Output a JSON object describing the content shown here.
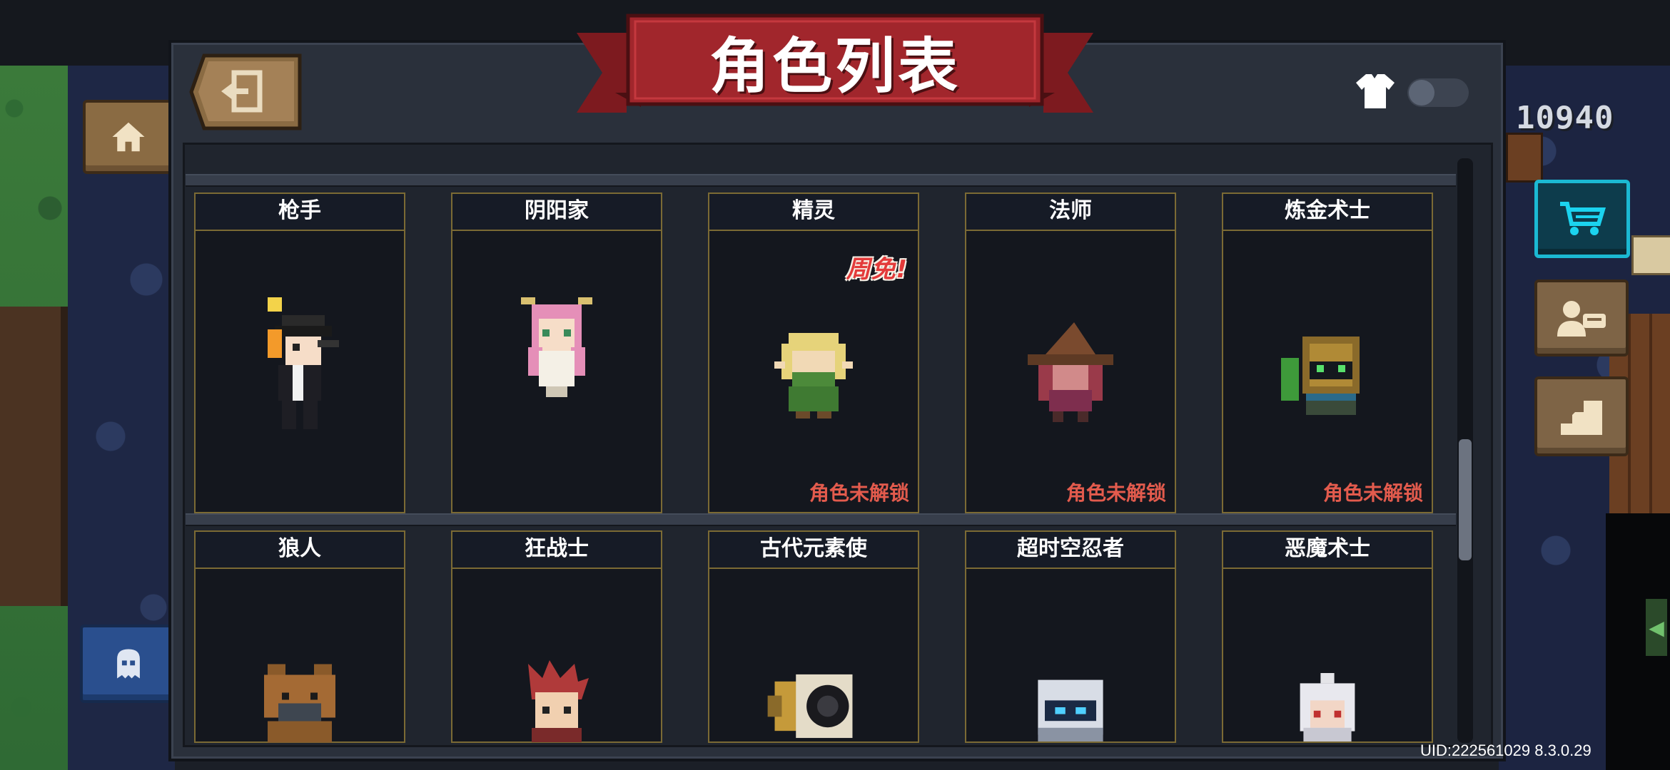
{
  "header": {
    "title": "角色列表",
    "coins": "10940"
  },
  "icons": {
    "exit": "exit-door-icon",
    "home": "home-icon",
    "ghost": "ghost-icon",
    "cart": "shopping-cart-icon",
    "profile": "profile-card-icon",
    "levelup": "level-up-icon",
    "skin": "shirt-icon"
  },
  "characters": [
    {
      "name": "枪手",
      "badge": "",
      "status": ""
    },
    {
      "name": "阴阳家",
      "badge": "",
      "status": ""
    },
    {
      "name": "精灵",
      "badge": "周免!",
      "status": "角色未解锁"
    },
    {
      "name": "法师",
      "badge": "",
      "status": "角色未解锁"
    },
    {
      "name": "炼金术士",
      "badge": "",
      "status": "角色未解锁"
    },
    {
      "name": "狼人",
      "badge": "",
      "status": ""
    },
    {
      "name": "狂战士",
      "badge": "",
      "status": ""
    },
    {
      "name": "古代元素使",
      "badge": "",
      "status": ""
    },
    {
      "name": "超时空忍者",
      "badge": "",
      "status": ""
    },
    {
      "name": "恶魔术士",
      "badge": "",
      "status": ""
    }
  ],
  "footer": {
    "uid": "UID:222561029 8.3.0.29"
  },
  "colors": {
    "banner": "#a1262c",
    "card_border": "#7b6a34",
    "locked_text": "#e35b4d",
    "accent_cyan": "#1bb9d3"
  }
}
